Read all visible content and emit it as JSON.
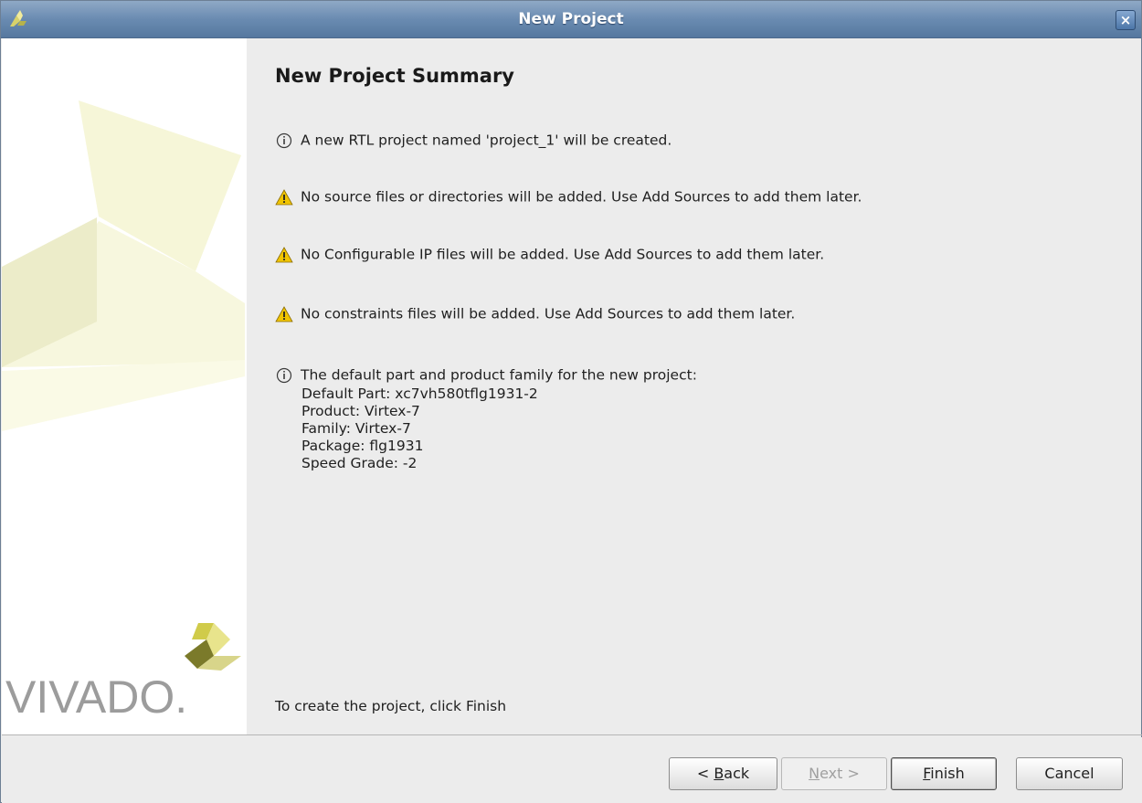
{
  "window": {
    "title": "New Project"
  },
  "sidebar": {
    "logo_text": "VIVADO."
  },
  "summary": {
    "heading": "New Project Summary",
    "messages": [
      {
        "icon": "info-icon",
        "text": "A new RTL project named 'project_1' will be created."
      },
      {
        "icon": "warning-icon",
        "text": "No source files or directories will be added. Use Add Sources to add them later."
      },
      {
        "icon": "warning-icon",
        "text": "No Configurable IP files will be added. Use Add Sources to add them later."
      },
      {
        "icon": "warning-icon",
        "text": "No constraints files will be added. Use Add Sources to add them later."
      },
      {
        "icon": "info-icon",
        "text": "The default part and product family for the new project:"
      }
    ],
    "part_details": [
      "Default Part: xc7vh580tflg1931-2",
      "Product: Virtex-7",
      "Family: Virtex-7",
      "Package: flg1931",
      "Speed Grade: -2"
    ],
    "footer_note": "To create the project, click Finish"
  },
  "buttons": {
    "back_prefix": "< ",
    "back_mnemonic": "B",
    "back_rest": "ack",
    "next_mnemonic": "N",
    "next_rest": "ext >",
    "finish_mnemonic": "F",
    "finish_rest": "inish",
    "cancel": "Cancel"
  },
  "colors": {
    "titlebar": "#6a8bb1",
    "info_icon": "#3a3a3a",
    "warning_icon": "#e8c000",
    "logo_shape_light": "#f3f3d0",
    "logo_shape_olive": "#c9ca86",
    "logo_text": "#9a9a9a"
  }
}
